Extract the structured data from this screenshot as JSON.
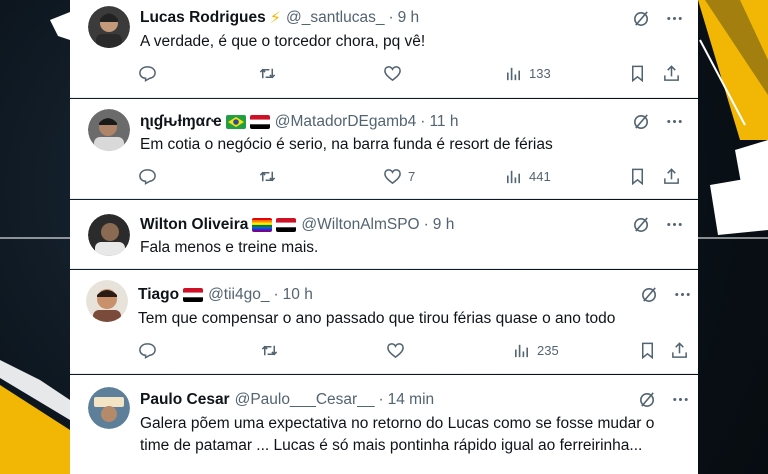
{
  "colors": {
    "text": "#0f1419",
    "muted": "#536471",
    "accent_yellow": "#f2b705",
    "background_dark": "#0d1620"
  },
  "replies": [
    {
      "name": "Lucas Rodrigues",
      "badge_icon": "lightning-emoji-icon",
      "handle": "@_santlucas_",
      "time": "9 h",
      "text": [
        "A verdade, é que o torcedor chora, pq vê!"
      ],
      "replies_count": "",
      "reposts_count": "",
      "likes_count": "",
      "views_count": "133"
    },
    {
      "name": "ɳιɠԋƚɱαɾҽ",
      "badge_icon": "brazil-flag-icon egypt-flag-icon",
      "handle": "@MatadorDEgamb4",
      "time": "11 h",
      "text": [
        "Em cotia o negócio é serio, na barra funda é resort de férias"
      ],
      "replies_count": "",
      "reposts_count": "",
      "likes_count": "7",
      "views_count": "441"
    },
    {
      "name": "Wilton Oliveira",
      "badge_icon": "rainbow-flag-icon egypt-flag-icon",
      "handle": "@WiltonAlmSPO",
      "time": "9 h",
      "text": [
        "Fala menos e treine mais."
      ]
    },
    {
      "name": "Tiago",
      "badge_icon": "egypt-flag-icon",
      "handle": "@tii4go_",
      "time": "10 h",
      "text": [
        "Tem que compensar o ano passado que tirou férias quase o ano todo"
      ],
      "replies_count": "",
      "reposts_count": "",
      "likes_count": "",
      "views_count": "235"
    },
    {
      "name": "Paulo Cesar",
      "badge_icon": "",
      "handle": "@Paulo___Cesar__",
      "time": "14 min",
      "text": [
        "Galera põem uma expectativa no retorno do Lucas como se fosse mudar o",
        "time de patamar ... Lucas é só mais pontinha rápido igual ao ferreirinha..."
      ]
    }
  ],
  "dot_separator": "·"
}
